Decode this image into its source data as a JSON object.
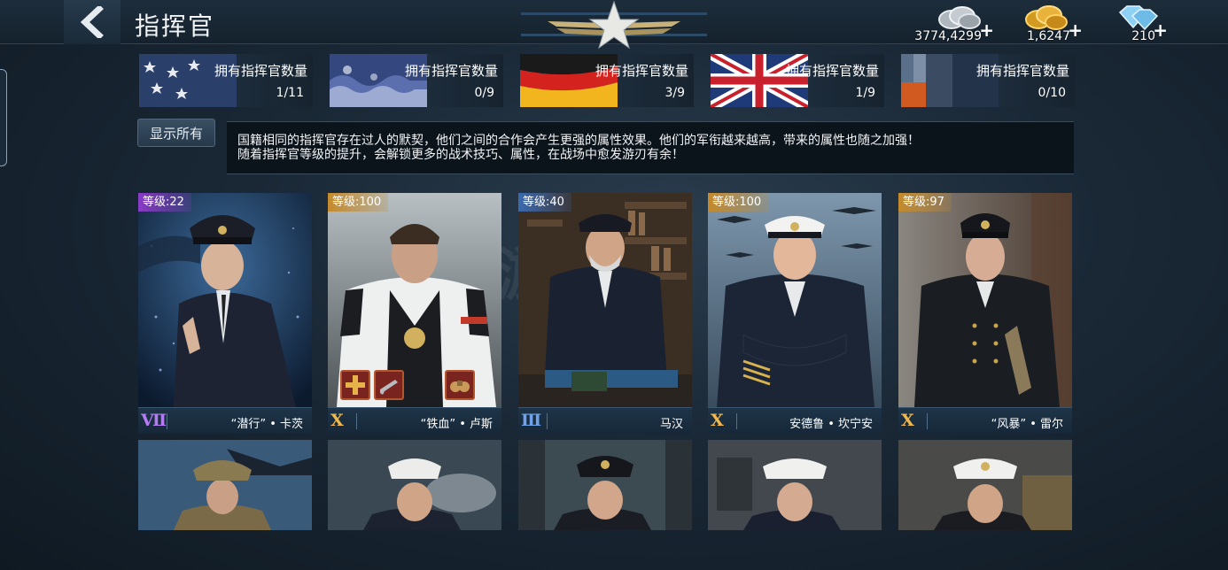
{
  "header": {
    "title": "指挥官",
    "currencies": [
      {
        "name": "silver",
        "value": "3774,4299",
        "color": "#c7ced6"
      },
      {
        "name": "gold",
        "value": "1,6247",
        "color": "#e9b23a"
      },
      {
        "name": "diamond",
        "value": "210",
        "color": "#8fd0f5"
      }
    ],
    "plus_label": "+"
  },
  "nations": [
    {
      "label": "拥有指挥官数量",
      "count": "1/11",
      "flag": "usa"
    },
    {
      "label": "拥有指挥官数量",
      "count": "0/9",
      "flag": "japan"
    },
    {
      "label": "拥有指挥官数量",
      "count": "3/9",
      "flag": "germany"
    },
    {
      "label": "拥有指挥官数量",
      "count": "1/9",
      "flag": "uk"
    },
    {
      "label": "拥有指挥官数量",
      "count": "0/10",
      "flag": "soviet"
    }
  ],
  "show_all_label": "显示所有",
  "description": {
    "line1": "国籍相同的指挥官存在过人的默契，他们之间的合作会产生更强的属性效果。他们的军衔越来越高，带来的属性也随之加强！",
    "line2": "随着指挥官等级的提升，会解锁更多的战术技巧、属性，在战场中愈发游刃有余！"
  },
  "commanders": [
    {
      "level": "等级:22",
      "rank": "Ⅶ",
      "name": "“潜行” • 卡茨",
      "tier": "purple"
    },
    {
      "level": "等级:100",
      "rank": "Ⅹ",
      "name": "“铁血” • 卢斯",
      "tier": "gold"
    },
    {
      "level": "等级:40",
      "rank": "Ⅲ",
      "name": "马汉",
      "tier": "blue"
    },
    {
      "level": "等级:100",
      "rank": "Ⅹ",
      "name": "安德鲁 • 坎宁安",
      "tier": "gold"
    },
    {
      "level": "等级:97",
      "rank": "Ⅹ",
      "name": "“风暴” • 雷尔",
      "tier": "gold"
    }
  ],
  "watermark": "游戏狗"
}
